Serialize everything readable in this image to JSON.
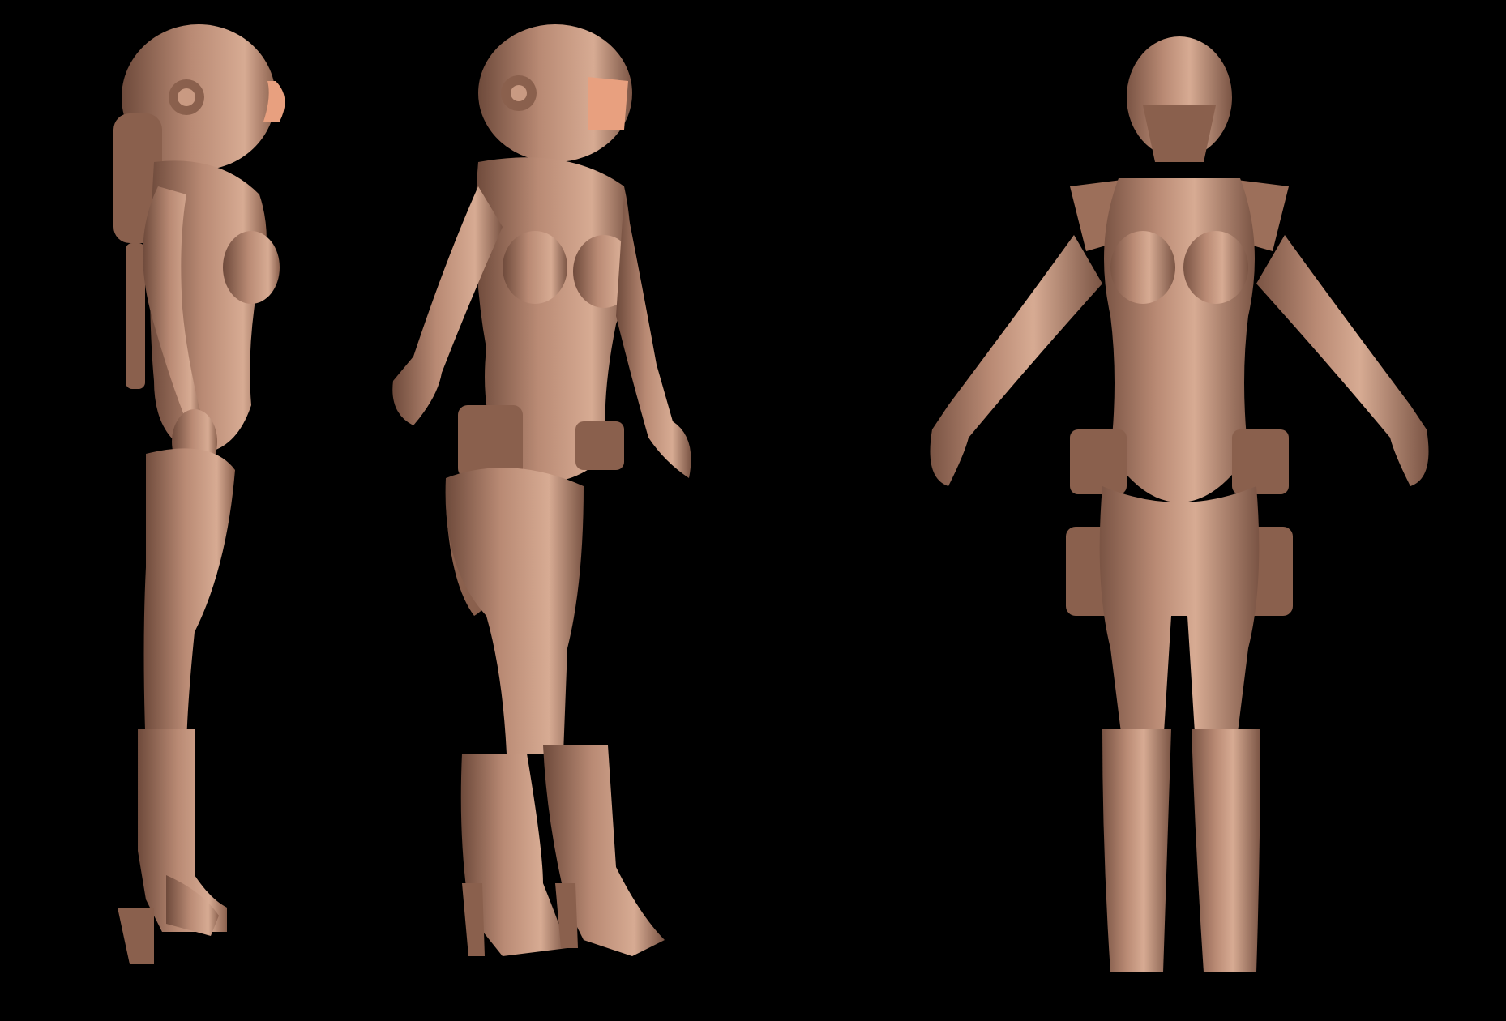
{
  "scene": {
    "background_color": "#000000",
    "clay_color": "#b98a74",
    "clay_shadow": "#6e4a3b",
    "clay_highlight": "#d7ab93",
    "visor_color": "#e8a07f"
  },
  "figures": [
    {
      "view": "side",
      "icon": "side-view-sculpt"
    },
    {
      "view": "three-quarter",
      "icon": "three-quarter-view-sculpt"
    },
    {
      "view": "front",
      "icon": "front-view-sculpt"
    }
  ]
}
